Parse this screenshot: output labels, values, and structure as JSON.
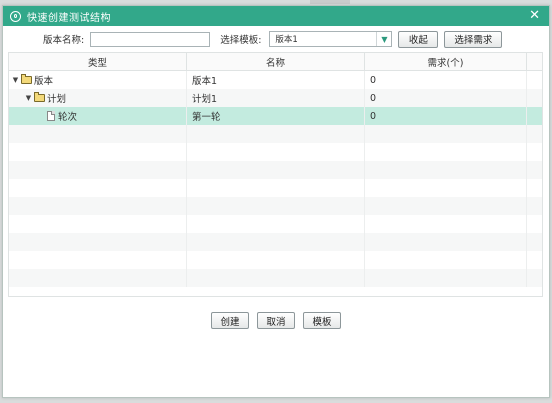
{
  "dialog": {
    "title": "快速创建测试结构",
    "close_symbol": "✕"
  },
  "toolbar": {
    "version_name_label": "版本名称:",
    "version_name_value": "",
    "version_name_placeholder": "",
    "template_label": "选择模板:",
    "template_selected": "版本1",
    "collapse_label": "收起",
    "select_requirements_label": "选择需求"
  },
  "grid": {
    "headers": {
      "type": "类型",
      "name": "名称",
      "requirements": "需求(个)"
    },
    "rows": [
      {
        "indent_level": 0,
        "icon": "folder-icon",
        "expanded": true,
        "type": "版本",
        "name": "版本1",
        "requirements": "0"
      },
      {
        "indent_level": 1,
        "icon": "folder-icon",
        "expanded": true,
        "type": "计划",
        "name": "计划1",
        "requirements": "0"
      },
      {
        "indent_level": 2,
        "icon": "file-icon",
        "expanded": false,
        "type": "轮次",
        "name": "第一轮",
        "requirements": "0",
        "selected": true
      }
    ],
    "toggle_symbol": "▼"
  },
  "footer": {
    "create_label": "创建",
    "cancel_label": "取消",
    "template_label": "模板"
  },
  "colors": {
    "titlebar": "#32a88a",
    "selected_row": "#c3ebdf"
  }
}
